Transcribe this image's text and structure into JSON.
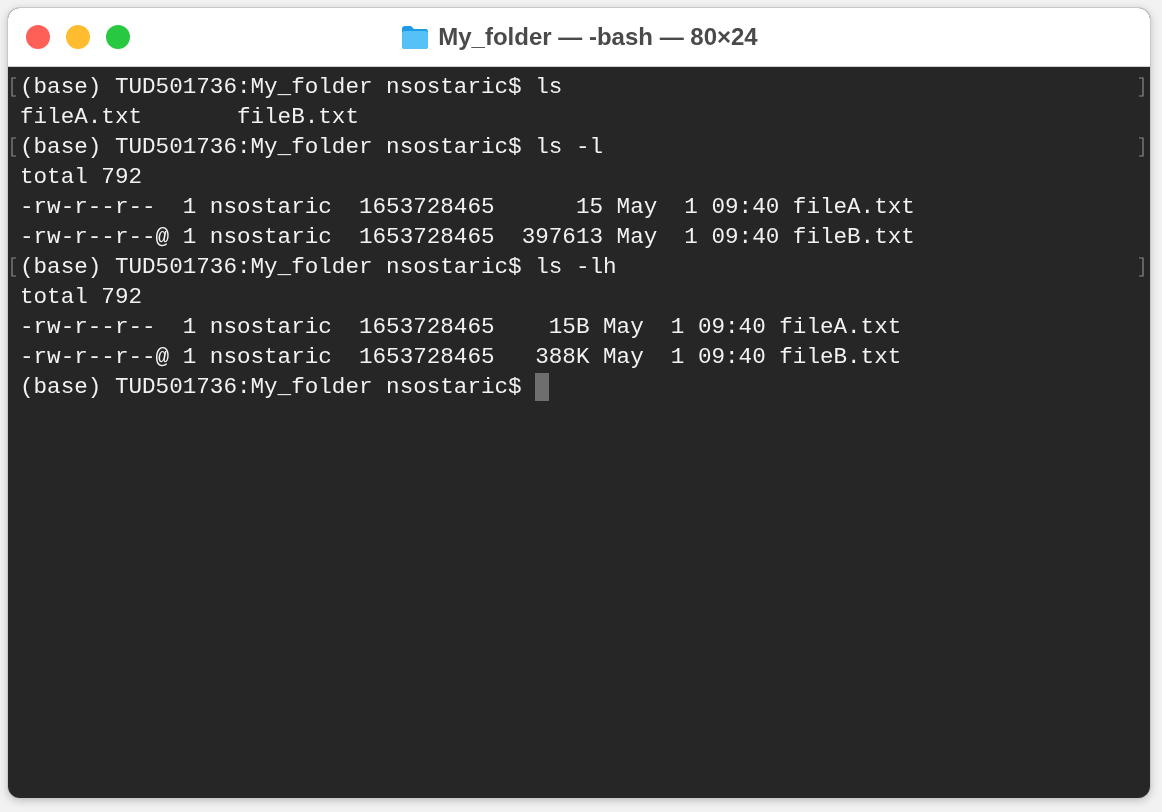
{
  "window": {
    "title": "My_folder — -bash — 80×24"
  },
  "terminal": {
    "lines": [
      {
        "text": "(base) TUD501736:My_folder nsostaric$ ls",
        "marked": true
      },
      {
        "text": "fileA.txt       fileB.txt",
        "marked": false
      },
      {
        "text": "(base) TUD501736:My_folder nsostaric$ ls -l",
        "marked": true
      },
      {
        "text": "total 792",
        "marked": false
      },
      {
        "text": "-rw-r--r--  1 nsostaric  1653728465      15 May  1 09:40 fileA.txt",
        "marked": false
      },
      {
        "text": "-rw-r--r--@ 1 nsostaric  1653728465  397613 May  1 09:40 fileB.txt",
        "marked": false
      },
      {
        "text": "(base) TUD501736:My_folder nsostaric$ ls -lh",
        "marked": true
      },
      {
        "text": "total 792",
        "marked": false
      },
      {
        "text": "-rw-r--r--  1 nsostaric  1653728465    15B May  1 09:40 fileA.txt",
        "marked": false
      },
      {
        "text": "-rw-r--r--@ 1 nsostaric  1653728465   388K May  1 09:40 fileB.txt",
        "marked": false
      },
      {
        "text": "(base) TUD501736:My_folder nsostaric$ ",
        "marked": false,
        "cursor": true
      }
    ]
  }
}
